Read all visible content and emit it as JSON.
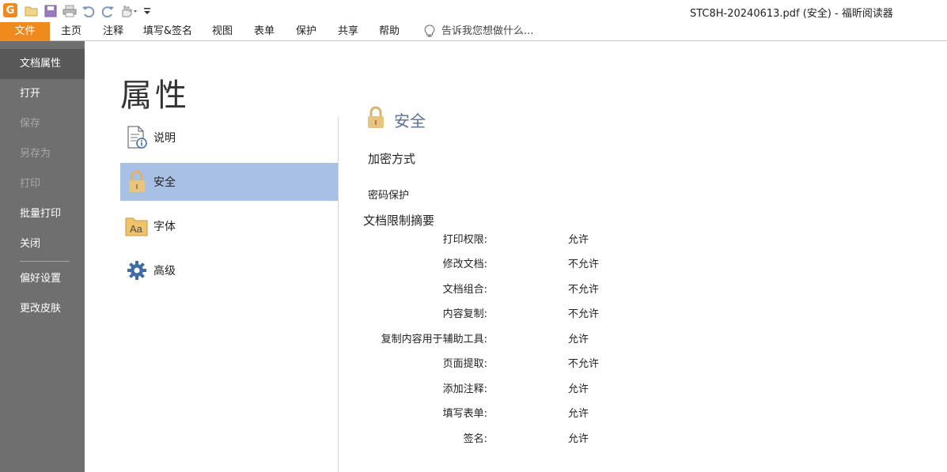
{
  "window": {
    "title": "STC8H-20240613.pdf (安全) - 福昕阅读器",
    "logo_letter": "G"
  },
  "quick_access": [
    "open-icon",
    "save-icon",
    "print-icon",
    "undo-icon",
    "redo-icon",
    "hand-tool-icon",
    "customize-dropdown-icon"
  ],
  "ribbon": {
    "tabs": [
      "文件",
      "主页",
      "注释",
      "填写&签名",
      "视图",
      "表单",
      "保护",
      "共享",
      "帮助"
    ],
    "tell_me": "告诉我您想做什么..."
  },
  "sidebar": {
    "items": [
      {
        "label": "文档属性",
        "state": "active"
      },
      {
        "label": "打开",
        "state": "normal"
      },
      {
        "label": "保存",
        "state": "disabled"
      },
      {
        "label": "另存为",
        "state": "disabled"
      },
      {
        "label": "打印",
        "state": "disabled"
      },
      {
        "label": "批量打印",
        "state": "normal"
      },
      {
        "label": "关闭",
        "state": "normal"
      },
      {
        "label": "偏好设置",
        "state": "normal"
      },
      {
        "label": "更改皮肤",
        "state": "normal"
      }
    ]
  },
  "page": {
    "title": "属性",
    "categories": [
      {
        "label": "说明",
        "icon": "document-info-icon"
      },
      {
        "label": "安全",
        "icon": "lock-icon",
        "selected": true
      },
      {
        "label": "字体",
        "icon": "font-folder-icon"
      },
      {
        "label": "高级",
        "icon": "gear-icon"
      }
    ]
  },
  "security": {
    "heading": "安全",
    "encryption_label": "加密方式",
    "encryption_value": "密码保护",
    "summary_label": "文档限制摘要",
    "permissions": [
      {
        "key": "打印权限:",
        "value": "允许"
      },
      {
        "key": "修改文档:",
        "value": "不允许"
      },
      {
        "key": "文档组合:",
        "value": "不允许"
      },
      {
        "key": "内容复制:",
        "value": "不允许"
      },
      {
        "key": "复制内容用于辅助工具:",
        "value": "允许"
      },
      {
        "key": "页面提取:",
        "value": "不允许"
      },
      {
        "key": "添加注释:",
        "value": "允许"
      },
      {
        "key": "填写表单:",
        "value": "允许"
      },
      {
        "key": "签名:",
        "value": "允许"
      }
    ]
  },
  "colors": {
    "accent": "#f08a1c",
    "sidebar_bg": "#6f6f6f",
    "selected_bg": "#a8c0e4",
    "heading_blue": "#5a6f94"
  }
}
